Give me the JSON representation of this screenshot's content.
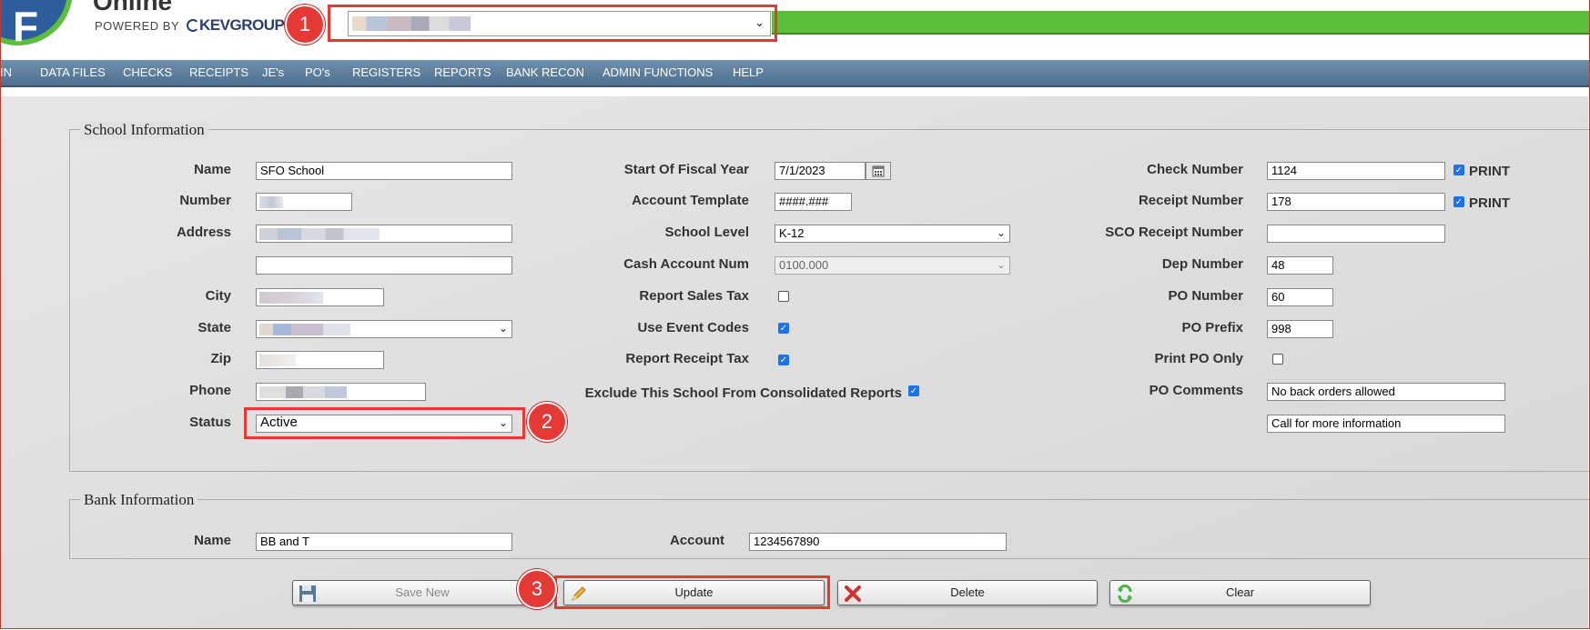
{
  "app": {
    "logo_letter": "F",
    "product_word": "Online",
    "powered_by": "POWERED BY",
    "brand": "KEVGROUP"
  },
  "nav": {
    "items": [
      "IN",
      "DATA FILES",
      "CHECKS",
      "RECEIPTS",
      "JE's",
      "PO's",
      "REGISTERS",
      "REPORTS",
      "BANK RECON",
      "ADMIN FUNCTIONS",
      "HELP"
    ]
  },
  "school_info": {
    "legend": "School Information",
    "name_label": "Name",
    "name_value": "SFO School",
    "number_label": "Number",
    "address_label": "Address",
    "city_label": "City",
    "state_label": "State",
    "zip_label": "Zip",
    "phone_label": "Phone",
    "status_label": "Status",
    "status_value": "Active",
    "fiscal_label": "Start Of Fiscal Year",
    "fiscal_value": "7/1/2023",
    "template_label": "Account Template",
    "template_value": "####.###",
    "level_label": "School Level",
    "level_value": "K-12",
    "cash_label": "Cash Account Num",
    "cash_value": "0100.000",
    "sales_tax_label": "Report Sales Tax",
    "event_codes_label": "Use Event Codes",
    "receipt_tax_label": "Report Receipt Tax",
    "exclude_label": "Exclude This School From Consolidated Reports",
    "check_num_label": "Check Number",
    "check_num_value": "1124",
    "receipt_num_label": "Receipt Number",
    "receipt_num_value": "178",
    "print_label": "PRINT",
    "sco_label": "SCO Receipt Number",
    "sco_value": "",
    "dep_label": "Dep Number",
    "dep_value": "48",
    "po_num_label": "PO Number",
    "po_num_value": "60",
    "po_prefix_label": "PO Prefix",
    "po_prefix_value": "998",
    "print_po_label": "Print PO Only",
    "po_comments_label": "PO Comments",
    "po_comment_1": "No back orders allowed",
    "po_comment_2": "Call for more information"
  },
  "bank_info": {
    "legend": "Bank Information",
    "name_label": "Name",
    "name_value": "BB and T",
    "account_label": "Account",
    "account_value": "1234567890"
  },
  "buttons": {
    "save_new": "Save New",
    "update": "Update",
    "delete": "Delete",
    "clear": "Clear"
  },
  "callouts": [
    "1",
    "2",
    "3"
  ],
  "checkbox_states": {
    "print_check": true,
    "print_receipt": true,
    "report_sales_tax": false,
    "use_event_codes": true,
    "report_receipt_tax": true,
    "exclude_consolidated": true,
    "print_po_only": false
  },
  "colors": {
    "accent_green": "#5cbf3a",
    "nav_blue": "#5a7a99",
    "callout_red": "#e53935",
    "logo_blue": "#2d5d9c"
  }
}
